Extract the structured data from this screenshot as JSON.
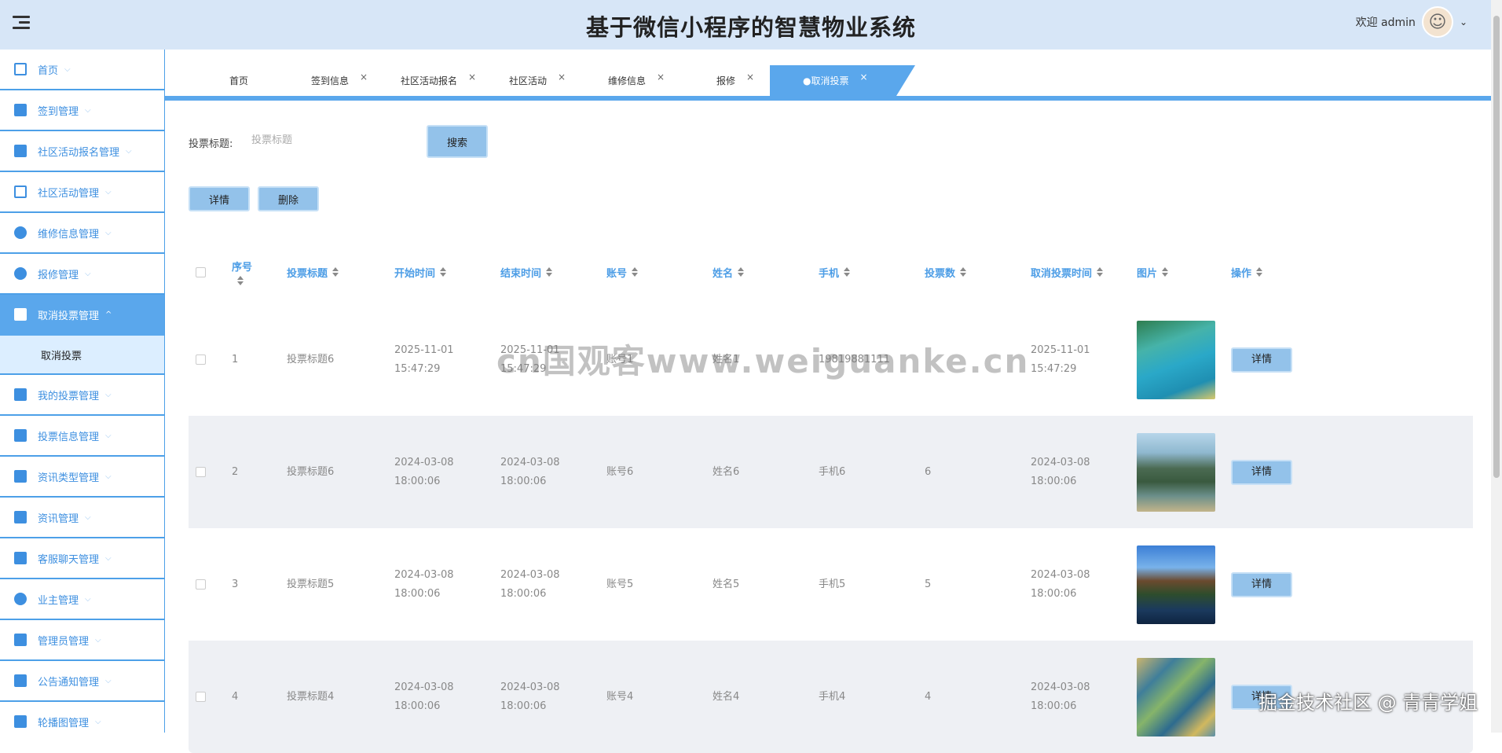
{
  "header": {
    "title": "基于微信小程序的智慧物业系统",
    "welcome": "欢迎 admin"
  },
  "sidebar": {
    "items": [
      {
        "label": "首页",
        "icon": "home-icon"
      },
      {
        "label": "签到管理",
        "icon": "image-icon"
      },
      {
        "label": "社区活动报名管理",
        "icon": "grid-icon"
      },
      {
        "label": "社区活动管理",
        "icon": "panel-icon"
      },
      {
        "label": "维修信息管理",
        "icon": "disc-icon"
      },
      {
        "label": "报修管理",
        "icon": "gauge-icon"
      },
      {
        "label": "取消投票管理",
        "icon": "building-icon",
        "active": true
      },
      {
        "label": "我的投票管理",
        "icon": "image-icon"
      },
      {
        "label": "投票信息管理",
        "icon": "mail-icon"
      },
      {
        "label": "资讯类型管理",
        "icon": "ticket-icon"
      },
      {
        "label": "资讯管理",
        "icon": "doc-icon"
      },
      {
        "label": "客服聊天管理",
        "icon": "briefcase-icon"
      },
      {
        "label": "业主管理",
        "icon": "drop-icon"
      },
      {
        "label": "管理员管理",
        "icon": "columns-icon"
      },
      {
        "label": "公告通知管理",
        "icon": "chart-icon"
      },
      {
        "label": "轮播图管理",
        "icon": "carousel-icon"
      }
    ],
    "sub_item": "取消投票"
  },
  "tabs": [
    {
      "label": "首页"
    },
    {
      "label": "签到信息"
    },
    {
      "label": "社区活动报名"
    },
    {
      "label": "社区活动"
    },
    {
      "label": "维修信息"
    },
    {
      "label": "报修"
    },
    {
      "label": "●取消投票"
    }
  ],
  "tab_close": "×",
  "search": {
    "label": "投票标题:",
    "placeholder": "投票标题",
    "button": "搜索"
  },
  "toolbar": {
    "detail": "详情",
    "delete": "删除"
  },
  "table": {
    "headers": [
      "序号",
      "投票标题",
      "开始时间",
      "结束时间",
      "账号",
      "姓名",
      "手机",
      "投票数",
      "取消投票时间",
      "图片",
      "操作"
    ],
    "rows": [
      {
        "index": "1",
        "title": "投票标题6",
        "start": "2025-11-01 15:47:29",
        "end": "2025-11-01 15:47:29",
        "account": "账号1",
        "name": "姓名1",
        "phone": "19819881111",
        "votes": "",
        "cancel_time": "2025-11-01 15:47:29",
        "action": "详情"
      },
      {
        "index": "2",
        "title": "投票标题6",
        "start": "2024-03-08 18:00:06",
        "end": "2024-03-08 18:00:06",
        "account": "账号6",
        "name": "姓名6",
        "phone": "手机6",
        "votes": "6",
        "cancel_time": "2024-03-08 18:00:06",
        "action": "详情"
      },
      {
        "index": "3",
        "title": "投票标题5",
        "start": "2024-03-08 18:00:06",
        "end": "2024-03-08 18:00:06",
        "account": "账号5",
        "name": "姓名5",
        "phone": "手机5",
        "votes": "5",
        "cancel_time": "2024-03-08 18:00:06",
        "action": "详情"
      },
      {
        "index": "4",
        "title": "投票标题4",
        "start": "2024-03-08 18:00:06",
        "end": "2024-03-08 18:00:06",
        "account": "账号4",
        "name": "姓名4",
        "phone": "手机4",
        "votes": "4",
        "cancel_time": "2024-03-08 18:00:06",
        "action": "详情"
      }
    ]
  },
  "watermark": {
    "center": "cn国观客www.weiguanke.cn",
    "corner": "掘金技术社区 @ 青青学姐"
  }
}
